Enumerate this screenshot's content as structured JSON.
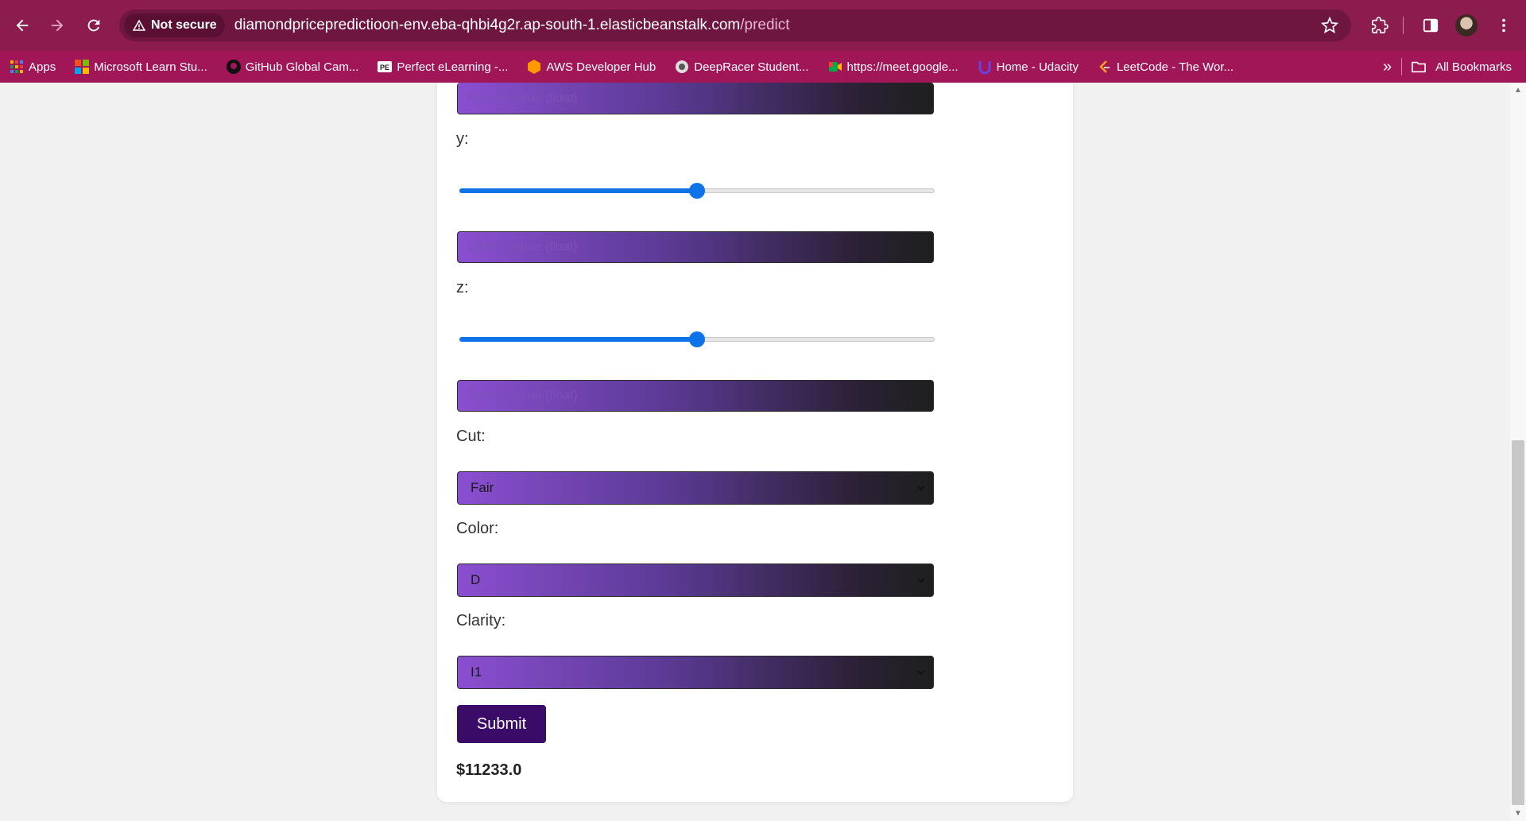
{
  "browser": {
    "security_label": "Not secure",
    "url_host": "diamondpricepredictioon-env.eba-qhbi4g2r.ap-south-1.elasticbeanstalk.com",
    "url_path": "/predict",
    "bookmarks": [
      {
        "label": "Apps",
        "icon": "apps-grid-icon"
      },
      {
        "label": "Microsoft Learn Stu...",
        "icon": "microsoft-icon"
      },
      {
        "label": "GitHub Global Cam...",
        "icon": "github-icon"
      },
      {
        "label": "Perfect eLearning -...",
        "icon": "pe-icon"
      },
      {
        "label": "AWS Developer Hub",
        "icon": "aws-icon"
      },
      {
        "label": "DeepRacer Student...",
        "icon": "deepracer-icon"
      },
      {
        "label": "https://meet.google...",
        "icon": "meet-icon"
      },
      {
        "label": "Home - Udacity",
        "icon": "udacity-icon"
      },
      {
        "label": "LeetCode - The Wor...",
        "icon": "leetcode-icon"
      }
    ],
    "all_bookmarks_label": "All Bookmarks"
  },
  "form": {
    "x_placeholder": "Enter x value (float)",
    "y_label": "y:",
    "y_slider_value": 0.5,
    "y_placeholder": "Enter y value (float)",
    "z_label": "z:",
    "z_slider_value": 0.5,
    "z_placeholder": "Enter z value (float)",
    "cut_label": "Cut:",
    "cut_value": "Fair",
    "color_label": "Color:",
    "color_value": "D",
    "clarity_label": "Clarity:",
    "clarity_value": "I1",
    "submit_label": "Submit",
    "result": "$11233.0"
  },
  "colors": {
    "browser_frame": "#8c1b4e",
    "bookmark_bar": "#a01656",
    "slider_blue": "#0e72e8",
    "submit_bg": "#3a0b67"
  }
}
